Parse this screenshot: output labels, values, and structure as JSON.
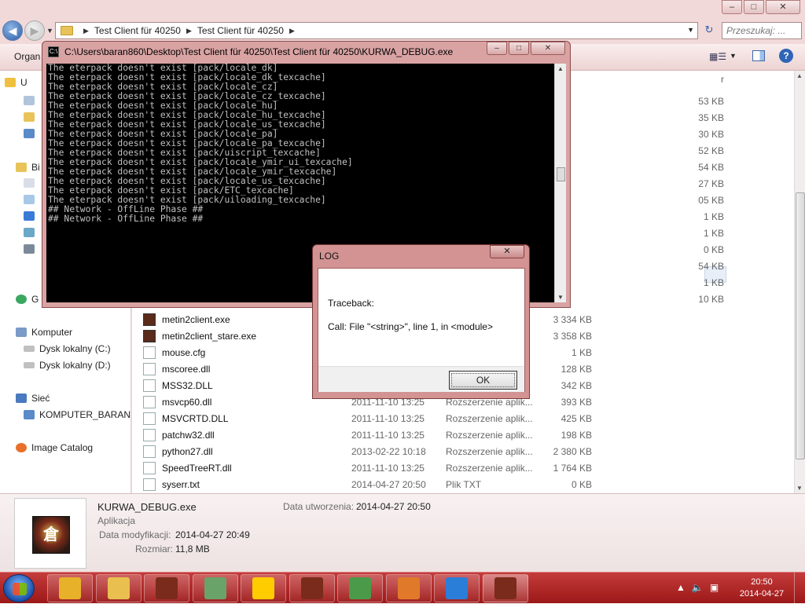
{
  "explorer": {
    "window_controls": [
      "–",
      "□",
      "✕"
    ],
    "breadcrumb": [
      "Test Client für 40250",
      "Test Client für 40250"
    ],
    "search_placeholder": "Przeszukaj: ...",
    "toolbar": {
      "organize": "Organ"
    },
    "nav": {
      "fav_letter": "U",
      "lib_letter": "Bi",
      "net_letter": "G",
      "computer": "Komputer",
      "drive_c": "Dysk lokalny (C:)",
      "drive_d": "Dysk lokalny (D:)",
      "network": "Sieć",
      "pc_name": "KOMPUTER_BARAN",
      "image_catalog": "Image Catalog"
    },
    "size_header_fragment": "r",
    "partial_sizes": [
      "53 KB",
      "35 KB",
      "30 KB",
      "52 KB",
      "54 KB",
      "27 KB",
      "05 KB",
      "1 KB",
      "1 KB",
      "0 KB",
      "54 KB",
      "1 KB",
      "10 KB"
    ],
    "files": [
      {
        "name": "metin2client.exe",
        "date": "",
        "type": "",
        "size": "3 334 KB",
        "kind": "exe"
      },
      {
        "name": "metin2client_stare.exe",
        "date": "",
        "type": "",
        "size": "3 358 KB",
        "kind": "exe"
      },
      {
        "name": "mouse.cfg",
        "date": "",
        "type": "",
        "size": "1 KB",
        "kind": "file"
      },
      {
        "name": "mscoree.dll",
        "date": "",
        "type": "",
        "size": "128 KB",
        "kind": "dll"
      },
      {
        "name": "MSS32.DLL",
        "date": "",
        "type": "",
        "size": "342 KB",
        "kind": "dll"
      },
      {
        "name": "msvcp60.dll",
        "date": "2011-11-10 13:25",
        "type": "Rozszerzenie aplik...",
        "size": "393 KB",
        "kind": "dll"
      },
      {
        "name": "MSVCRTD.DLL",
        "date": "2011-11-10 13:25",
        "type": "Rozszerzenie aplik...",
        "size": "425 KB",
        "kind": "dll"
      },
      {
        "name": "patchw32.dll",
        "date": "2011-11-10 13:25",
        "type": "Rozszerzenie aplik...",
        "size": "198 KB",
        "kind": "dll"
      },
      {
        "name": "python27.dll",
        "date": "2013-02-22 10:18",
        "type": "Rozszerzenie aplik...",
        "size": "2 380 KB",
        "kind": "dll"
      },
      {
        "name": "SpeedTreeRT.dll",
        "date": "2011-11-10 13:25",
        "type": "Rozszerzenie aplik...",
        "size": "1 764 KB",
        "kind": "dll"
      },
      {
        "name": "syserr.txt",
        "date": "2014-04-27 20:50",
        "type": "Plik TXT",
        "size": "0 KB",
        "kind": "file"
      }
    ],
    "details": {
      "filename": "KURWA_DEBUG.exe",
      "kind": "Aplikacja",
      "modified_label": "Data modyfikacji:",
      "modified_value": "2014-04-27 20:49",
      "size_label": "Rozmiar:",
      "size_value": "11,8 MB",
      "created_label": "Data utworzenia:",
      "created_value": "2014-04-27 20:50"
    }
  },
  "console": {
    "title": "C:\\Users\\baran860\\Desktop\\Test Client für 40250\\Test Client für 40250\\KURWA_DEBUG.exe",
    "controls": [
      "–",
      "□",
      "✕"
    ],
    "lines": [
      "The eterpack doesn't exist [pack/locale_dk]",
      "The eterpack doesn't exist [pack/locale_dk_texcache]",
      "The eterpack doesn't exist [pack/locale_cz]",
      "The eterpack doesn't exist [pack/locale_cz_texcache]",
      "The eterpack doesn't exist [pack/locale_hu]",
      "The eterpack doesn't exist [pack/locale_hu_texcache]",
      "The eterpack doesn't exist [pack/locale_us_texcache]",
      "The eterpack doesn't exist [pack/locale_pa]",
      "The eterpack doesn't exist [pack/locale_pa_texcache]",
      "The eterpack doesn't exist [pack/uiscript_texcache]",
      "The eterpack doesn't exist [pack/locale_ymir_ui_texcache]",
      "The eterpack doesn't exist [pack/locale_ymir_texcache]",
      "The eterpack doesn't exist [pack/locale_us_texcache]",
      "The eterpack doesn't exist [pack/ETC_texcache]",
      "The eterpack doesn't exist [pack/uiloading_texcache]",
      "",
      "",
      "",
      "## Network - OffLine Phase ##",
      "## Network - OffLine Phase ##"
    ]
  },
  "dialog": {
    "title": "LOG",
    "close": "✕",
    "line1": "Traceback:",
    "line2": "Call: File \"<string>\", line 1, in <module>",
    "ok": "OK"
  },
  "taskbar": {
    "time": "20:50",
    "date": "2014-04-27",
    "apps": [
      {
        "name": "chrome",
        "color": "#e8b12a"
      },
      {
        "name": "explorer",
        "color": "#e9c04f"
      },
      {
        "name": "metin2",
        "color": "#7a2b1b"
      },
      {
        "name": "network-monitor",
        "color": "#6aa36a"
      },
      {
        "name": "sun-app",
        "color": "#ffcc00"
      },
      {
        "name": "metin2",
        "color": "#7a2b1b"
      },
      {
        "name": "notepad-chart",
        "color": "#4a9a4a"
      },
      {
        "name": "app-settings",
        "color": "#e07a2a"
      },
      {
        "name": "teamviewer",
        "color": "#2a7ed8"
      },
      {
        "name": "metin2",
        "color": "#7a2b1b"
      }
    ]
  }
}
